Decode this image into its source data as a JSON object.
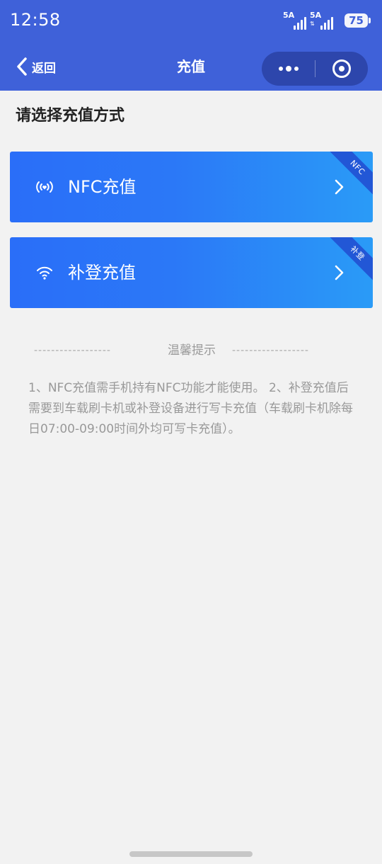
{
  "status_bar": {
    "time": "12:58",
    "signal_1_label": "5A",
    "signal_2_label": "5A",
    "battery": "75"
  },
  "nav": {
    "back_label": "返回",
    "title": "充值"
  },
  "page": {
    "section_title": "请选择充值方式",
    "options": [
      {
        "label": "NFC充值",
        "badge": "NFC",
        "icon": "nfc-icon"
      },
      {
        "label": "补登充值",
        "badge": "补登",
        "icon": "wifi-icon"
      }
    ],
    "tips": {
      "left_dashes": "------------------",
      "title": "温馨提示",
      "right_dashes": "------------------",
      "text": "1、NFC充值需手机持有NFC功能才能使用。 2、补登充值后需要到车载刷卡机或补登设备进行写卡充值（车载刷卡机除每日07:00-09:00时间外均可写卡充值）。"
    }
  },
  "colors": {
    "header": "#3f61d9",
    "capsule": "#2d46ac",
    "card_gradient_start": "#2a6ef8",
    "card_gradient_end": "#2a9bf7",
    "ribbon": "#2257d6",
    "background": "#f2f2f2"
  }
}
